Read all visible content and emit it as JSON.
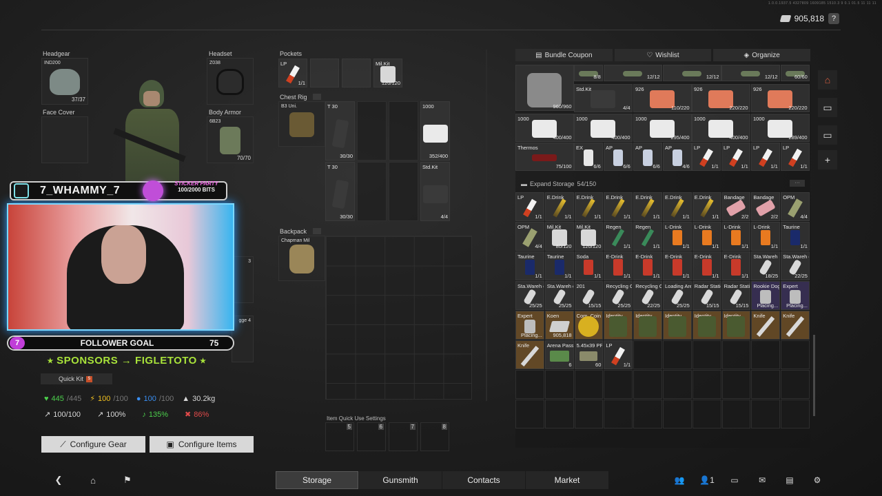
{
  "header": {
    "currency": "905,818",
    "help": "?",
    "version": "1.0.0.1937.5 4327809 1609185 1510.3 9 0.1 01.5 11 11 11"
  },
  "gear": {
    "headgear": {
      "label": "Headgear",
      "sub": "IND200",
      "count": "37/37"
    },
    "headset": {
      "label": "Headset",
      "sub": "Z038"
    },
    "face_cover": {
      "label": "Face Cover"
    },
    "body_armor": {
      "label": "Body Armor",
      "sub": "6B23",
      "count": "70/70"
    },
    "hidden_slot_a": "3",
    "hidden_slot_b": "gge 4"
  },
  "stream": {
    "name": "7_WHAMMY_7",
    "sticker_title": "STICKER PARTY",
    "sticker_bits": "100/2000 BITS",
    "follower_badge": "7",
    "follower_goal": "FOLLOWER GOAL",
    "follower_count": "75",
    "sponsor": "⭑ SPONSORS → FIGLETOTO ⭑"
  },
  "quick_kit": {
    "label": "Quick Kit",
    "badge": "5"
  },
  "stats": {
    "health": "445",
    "health_max": "/445",
    "energy": "100",
    "energy_max": "/100",
    "hydration": "100",
    "hydration_max": "/100",
    "weight": "30.2kg",
    "stat_a": "100/100",
    "stat_b": "100%",
    "stat_c": "135%",
    "stat_d": "86%"
  },
  "buttons": {
    "configure_gear": "Configure Gear",
    "configure_items": "Configure Items"
  },
  "containers": {
    "pockets_label": "Pockets",
    "pockets": [
      {
        "name": "LP",
        "count": "1/1"
      },
      {
        "name": "",
        "count": ""
      },
      {
        "name": "",
        "count": ""
      },
      {
        "name": "Mil.Kit",
        "count": "120/120"
      }
    ],
    "chest_rig_label": "Chest Rig",
    "chest_rig_sub": "B3 Uni.",
    "chest_items": [
      {
        "name": "T 30",
        "count": "30/30"
      },
      {
        "name": "1000",
        "count": "352/400"
      },
      {
        "name": "T 30",
        "count": "30/30"
      },
      {
        "name": "Std.Kit",
        "count": "4/4"
      }
    ],
    "backpack_label": "Backpack",
    "backpack_sub": "Chapman Mil",
    "quick_use_label": "Item Quick Use Settings",
    "quick_use_slots": [
      "5",
      "6",
      "7",
      "8"
    ]
  },
  "storage": {
    "tabs": [
      "Bundle Coupon",
      "Wishlist",
      "Organize"
    ],
    "expand_label": "Expand Storage",
    "expand_count": "54/150",
    "top_items": [
      {
        "name": "",
        "count": "8/8"
      },
      {
        "name": "",
        "count": "12/12"
      },
      {
        "name": "",
        "count": "12/12"
      },
      {
        "name": "",
        "count": "12/12"
      },
      {
        "name": "",
        "count": "60/60"
      },
      {
        "name": "",
        "count": "960/960"
      },
      {
        "name": "Std.Kit",
        "count": "4/4"
      },
      {
        "name": "926",
        "count": "110/220"
      },
      {
        "name": "926",
        "count": "220/220"
      },
      {
        "name": "926",
        "count": "220/220"
      },
      {
        "name": "1000",
        "count": "400/400"
      },
      {
        "name": "1000",
        "count": "400/400"
      },
      {
        "name": "1000",
        "count": "295/400"
      },
      {
        "name": "1000",
        "count": "400/400"
      },
      {
        "name": "1000",
        "count": "289/400"
      },
      {
        "name": "Thermos",
        "count": "75/100"
      },
      {
        "name": "EX",
        "count": "6/6"
      },
      {
        "name": "AP",
        "count": "6/6"
      },
      {
        "name": "AP",
        "count": "6/6"
      },
      {
        "name": "AP",
        "count": "4/6"
      },
      {
        "name": "LP",
        "count": "1/1"
      },
      {
        "name": "LP",
        "count": "1/1"
      },
      {
        "name": "LP",
        "count": "1/1"
      },
      {
        "name": "LP",
        "count": "1/1"
      }
    ],
    "items": [
      {
        "name": "LP",
        "count": "1/1"
      },
      {
        "name": "E.Drink",
        "count": "1/1"
      },
      {
        "name": "E.Drink",
        "count": "1/1"
      },
      {
        "name": "E.Drink",
        "count": "1/1"
      },
      {
        "name": "E.Drink",
        "count": "1/1"
      },
      {
        "name": "E.Drink",
        "count": "1/1"
      },
      {
        "name": "E.Drink",
        "count": "1/1"
      },
      {
        "name": "Bandage",
        "count": "2/2"
      },
      {
        "name": "Bandage",
        "count": "2/2"
      },
      {
        "name": "OPM",
        "count": "4/4"
      },
      {
        "name": "OPM",
        "count": "4/4"
      },
      {
        "name": "Mil.Kit",
        "count": "80/120"
      },
      {
        "name": "Mil.Kit",
        "count": "120/120"
      },
      {
        "name": "Regen",
        "count": "1/1"
      },
      {
        "name": "Regen",
        "count": "1/1"
      },
      {
        "name": "L-Drink",
        "count": "1/1"
      },
      {
        "name": "L-Drink",
        "count": "1/1"
      },
      {
        "name": "L-Drink",
        "count": "1/1"
      },
      {
        "name": "L-Drink",
        "count": "1/1"
      },
      {
        "name": "Taurine",
        "count": "1/1"
      },
      {
        "name": "Taurine",
        "count": "1/1"
      },
      {
        "name": "Taurine",
        "count": "1/1"
      },
      {
        "name": "Soda",
        "count": "1/1"
      },
      {
        "name": "E-Drink",
        "count": "1/1"
      },
      {
        "name": "E-Drink",
        "count": "1/1"
      },
      {
        "name": "E-Drink",
        "count": "1/1"
      },
      {
        "name": "E-Drink",
        "count": "1/1"
      },
      {
        "name": "E-Drink",
        "count": "1/1"
      },
      {
        "name": "Sta.Wareh ouse",
        "count": "18/25"
      },
      {
        "name": "Sta.Wareh ouse",
        "count": "22/25"
      },
      {
        "name": "Sta.Wareh ouse",
        "count": "25/25"
      },
      {
        "name": "Sta.Wareh ouse",
        "count": "25/25"
      },
      {
        "name": "201",
        "count": "15/15"
      },
      {
        "name": "Recycling Office",
        "count": "25/25"
      },
      {
        "name": "Recycling Office",
        "count": "22/25"
      },
      {
        "name": "Loading Area",
        "count": "25/25"
      },
      {
        "name": "Radar Station",
        "count": "15/15"
      },
      {
        "name": "Radar Station",
        "count": "15/15"
      },
      {
        "name": "Rookie Dog Tag",
        "count": "Placing..."
      },
      {
        "name": "Expert",
        "count": "Placing..."
      },
      {
        "name": "Expert",
        "count": "Placing..."
      },
      {
        "name": "Koen",
        "count": "905,818"
      },
      {
        "name": "Com. Coin",
        "count": ""
      },
      {
        "name": "Identity",
        "count": ""
      },
      {
        "name": "Identity",
        "count": ""
      },
      {
        "name": "Identity",
        "count": ""
      },
      {
        "name": "Identity",
        "count": ""
      },
      {
        "name": "Identity",
        "count": ""
      },
      {
        "name": "Knife",
        "count": ""
      },
      {
        "name": "Knife",
        "count": ""
      },
      {
        "name": "Knife",
        "count": ""
      },
      {
        "name": "Arena Pass",
        "count": "6"
      },
      {
        "name": "5.45x39 PP",
        "count": "60"
      },
      {
        "name": "LP",
        "count": "1/1"
      }
    ]
  },
  "nav": {
    "tabs": [
      "Storage",
      "Gunsmith",
      "Contacts",
      "Market"
    ],
    "active": "Storage",
    "friends_count": "1"
  },
  "colors": {
    "accent_green": "#a8e23a",
    "stream_purple": "#c03ed8",
    "cam_glow": "#2d9cff",
    "health": "#4ccf4c",
    "energy": "#f0c020",
    "hydration": "#3a8ef0",
    "danger": "#e04a4a"
  }
}
